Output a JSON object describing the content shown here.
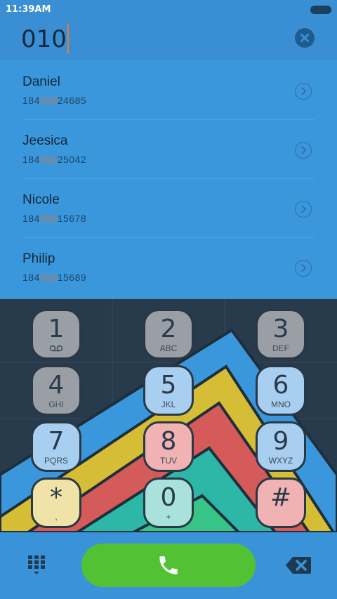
{
  "status_bar": {
    "time": "11:39AM"
  },
  "search": {
    "query": "010"
  },
  "contacts": [
    {
      "name": "Daniel",
      "number_before": "184",
      "number_match": "010",
      "number_after": "24685"
    },
    {
      "name": "Jeesica",
      "number_before": "184",
      "number_match": "010",
      "number_after": "25042"
    },
    {
      "name": "Nicole",
      "number_before": "184",
      "number_match": "010",
      "number_after": "15678"
    },
    {
      "name": "Philip",
      "number_before": "184",
      "number_match": "010",
      "number_after": "15689"
    }
  ],
  "dialpad": {
    "keys": [
      {
        "digit": "1",
        "letters": ""
      },
      {
        "digit": "2",
        "letters": "ABC"
      },
      {
        "digit": "3",
        "letters": "DEF"
      },
      {
        "digit": "4",
        "letters": "GHI"
      },
      {
        "digit": "5",
        "letters": "JKL"
      },
      {
        "digit": "6",
        "letters": "MNO"
      },
      {
        "digit": "7",
        "letters": "PQRS"
      },
      {
        "digit": "8",
        "letters": "TUV"
      },
      {
        "digit": "9",
        "letters": "WXYZ"
      },
      {
        "digit": "*",
        "letters": ","
      },
      {
        "digit": "0",
        "letters": "+"
      },
      {
        "digit": "#",
        "letters": ""
      }
    ]
  },
  "icons": {
    "clear": "close-circle-icon",
    "contact_arrow": "chevron-right-circle-icon",
    "voicemail": "voicemail-icon",
    "keypad": "keypad-icon",
    "call": "phone-icon",
    "backspace": "backspace-icon"
  },
  "colors": {
    "accent_blue": "#3b97db",
    "call_green": "#52c234",
    "match_highlight": "#d2733a",
    "dialpad_background": "#273b4d"
  }
}
